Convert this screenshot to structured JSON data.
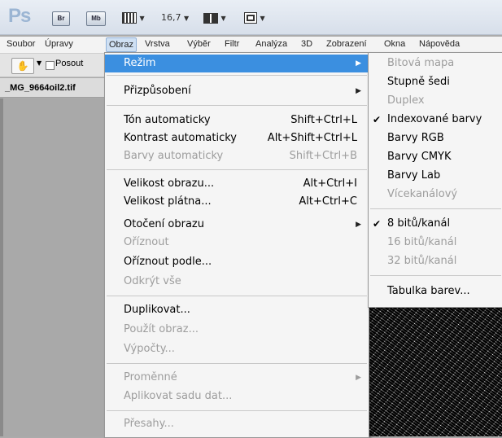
{
  "app": {
    "logo": "Ps",
    "br_label": "Br",
    "mb_label": "Mb",
    "zoom": "16,7"
  },
  "menubar": {
    "items": [
      "Soubor",
      "Úpravy",
      "Obraz",
      "Vrstva",
      "Výběr",
      "Filtr",
      "Analýza",
      "3D",
      "Zobrazení",
      "Okna",
      "Nápověda"
    ],
    "active": "Obraz"
  },
  "options": {
    "checkbox_label": "Posout"
  },
  "document": {
    "tab_title": "_MG_9664oil2.tif"
  },
  "image_menu": {
    "items": [
      {
        "label": "Režim",
        "submenu": true,
        "highlighted": true
      },
      {
        "label": "Přizpůsobení",
        "submenu": true
      },
      {
        "label": "Tón automaticky",
        "shortcut": "Shift+Ctrl+L"
      },
      {
        "label": "Kontrast automaticky",
        "shortcut": "Alt+Shift+Ctrl+L"
      },
      {
        "label": "Barvy automaticky",
        "shortcut": "Shift+Ctrl+B",
        "disabled": true
      },
      {
        "label": "Velikost obrazu...",
        "shortcut": "Alt+Ctrl+I"
      },
      {
        "label": "Velikost plátna...",
        "shortcut": "Alt+Ctrl+C"
      },
      {
        "label": "Otočení obrazu",
        "submenu": true
      },
      {
        "label": "Oříznout",
        "disabled": true
      },
      {
        "label": "Oříznout podle..."
      },
      {
        "label": "Odkrýt vše",
        "disabled": true
      },
      {
        "label": "Duplikovat..."
      },
      {
        "label": "Použít obraz...",
        "disabled": true
      },
      {
        "label": "Výpočty...",
        "disabled": true
      },
      {
        "label": "Proměnné",
        "submenu": true,
        "disabled": true
      },
      {
        "label": "Aplikovat sadu dat...",
        "disabled": true
      },
      {
        "label": "Přesahy...",
        "disabled": true
      }
    ]
  },
  "mode_submenu": {
    "items": [
      {
        "label": "Bitová mapa",
        "disabled": true
      },
      {
        "label": "Stupně šedi"
      },
      {
        "label": "Duplex",
        "disabled": true
      },
      {
        "label": "Indexované barvy",
        "checked": true
      },
      {
        "label": "Barvy RGB"
      },
      {
        "label": "Barvy CMYK"
      },
      {
        "label": "Barvy Lab"
      },
      {
        "label": "Vícekanálový",
        "disabled": true
      },
      {
        "label": "8 bitů/kanál",
        "checked": true
      },
      {
        "label": "16 bitů/kanál",
        "disabled": true
      },
      {
        "label": "32 bitů/kanál",
        "disabled": true
      },
      {
        "label": "Tabulka barev..."
      }
    ]
  },
  "icons": {
    "check": "check-icon",
    "submenu_arrow": "submenu-arrow-icon",
    "hand_tool": "hand-tool-icon"
  },
  "colors": {
    "highlight": "#3b8fe0",
    "disabled_text": "#9d9d9d",
    "menu_bg": "#f5f5f5"
  }
}
